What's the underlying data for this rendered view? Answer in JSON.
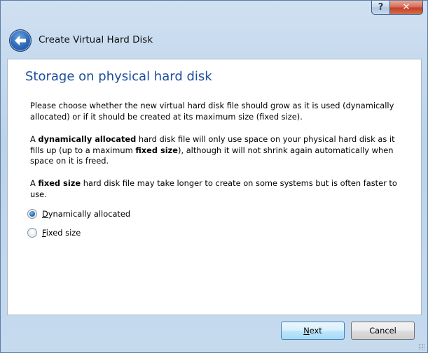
{
  "window": {
    "help_glyph": "?",
    "close_glyph": "✕"
  },
  "header": {
    "title": "Create Virtual Hard Disk"
  },
  "page": {
    "heading": "Storage on physical hard disk",
    "para1": "Please choose whether the new virtual hard disk file should grow as it is used (dynamically allocated) or if it should be created at its maximum size (fixed size).",
    "para2": {
      "t1": "A ",
      "b1": "dynamically allocated",
      "t2": " hard disk file will only use space on your physical hard disk as it fills up (up to a maximum ",
      "b2": "fixed size",
      "t3": "), although it will not shrink again automatically when space on it is freed."
    },
    "para3": {
      "t1": "A ",
      "b1": "fixed size",
      "t2": " hard disk file may take longer to create on some systems but is often faster to use."
    },
    "options": [
      {
        "mnemonic": "D",
        "rest": "ynamically allocated",
        "selected": true
      },
      {
        "mnemonic": "F",
        "rest": "ixed size",
        "selected": false
      }
    ]
  },
  "footer": {
    "next": {
      "mnemonic": "N",
      "rest": "ext"
    },
    "cancel": "Cancel"
  }
}
